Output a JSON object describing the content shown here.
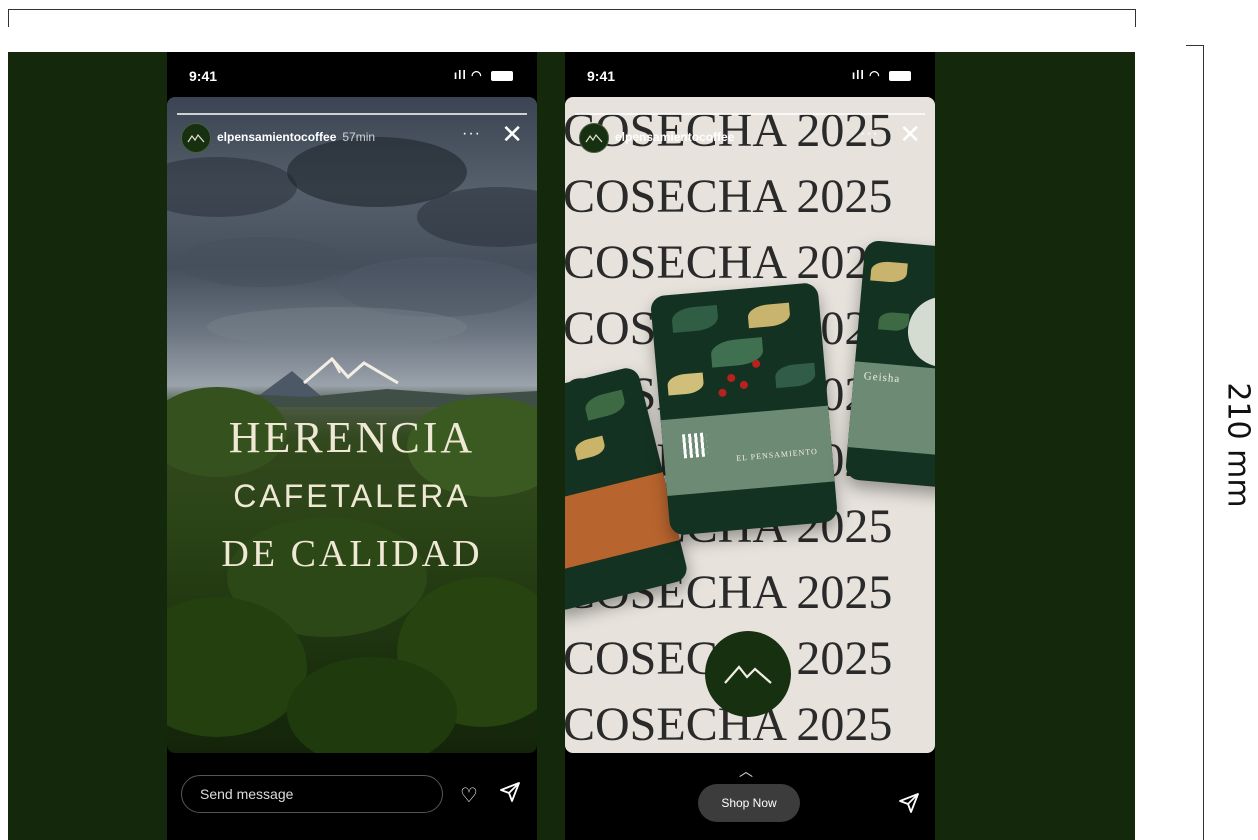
{
  "dimension": {
    "label": "210 mm"
  },
  "story_left": {
    "status_time": "9:41",
    "account": "elpensamientocoffee",
    "age": "57min",
    "more": "···",
    "close": "✕",
    "headline_1": "HERENCIA",
    "headline_2": "CAFETALERA",
    "headline_3": "DE CALIDAD",
    "message_placeholder": "Send message"
  },
  "story_right": {
    "status_time": "9:41",
    "account": "elpensamientocoffee",
    "more": "···",
    "close": "✕",
    "repeat_text": "COSECHA 2025",
    "bag_brand": "EL PENSAMIENTO",
    "bag_variety": "Geisha",
    "cta": "Shop Now",
    "swipe_hint": "︿"
  },
  "icons": {
    "signal": "signal-icon",
    "wifi": "wifi-icon",
    "battery": "battery-icon",
    "heart": "heart-icon",
    "send": "paper-plane-icon",
    "logo": "mountain-logo-icon"
  },
  "colors": {
    "brand_green": "#14280c",
    "cream": "#e7e3dc",
    "cream_text": "#efe8d4"
  }
}
